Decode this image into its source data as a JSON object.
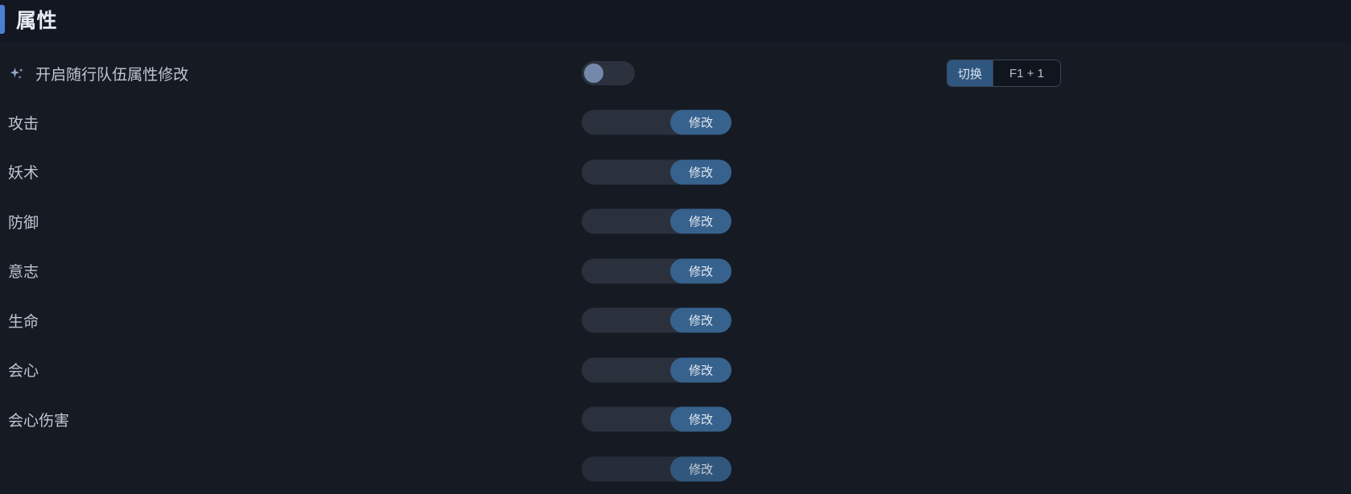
{
  "section": {
    "title": "属性",
    "accent_color": "#4b7fd4"
  },
  "theme": {
    "background": "#151a23",
    "header_background": "#121722",
    "input_pill": "#2b313c",
    "button_blue": "#36628d",
    "hotkey_blue": "#2f567f",
    "toggle_track": "#2c323d",
    "toggle_knob": "#7488ab",
    "text_primary": "#e8ecf2",
    "text_secondary": "#c0c6d0"
  },
  "feature_toggle": {
    "icon": "sparkle-icon",
    "label": "开启随行队伍属性修改",
    "enabled": false,
    "hotkey": {
      "action_label": "切换",
      "keys": "F1 + 1"
    }
  },
  "stat_rows": [
    {
      "label": "攻击",
      "value": "",
      "placeholder": "",
      "button_label": "修改"
    },
    {
      "label": "妖术",
      "value": "",
      "placeholder": "",
      "button_label": "修改"
    },
    {
      "label": "防御",
      "value": "",
      "placeholder": "",
      "button_label": "修改"
    },
    {
      "label": "意志",
      "value": "",
      "placeholder": "",
      "button_label": "修改"
    },
    {
      "label": "生命",
      "value": "",
      "placeholder": "",
      "button_label": "修改"
    },
    {
      "label": "会心",
      "value": "",
      "placeholder": "",
      "button_label": "修改"
    },
    {
      "label": "会心伤害",
      "value": "",
      "placeholder": "",
      "button_label": "修改"
    },
    {
      "label": "",
      "value": "",
      "placeholder": "",
      "button_label": "修改"
    }
  ]
}
